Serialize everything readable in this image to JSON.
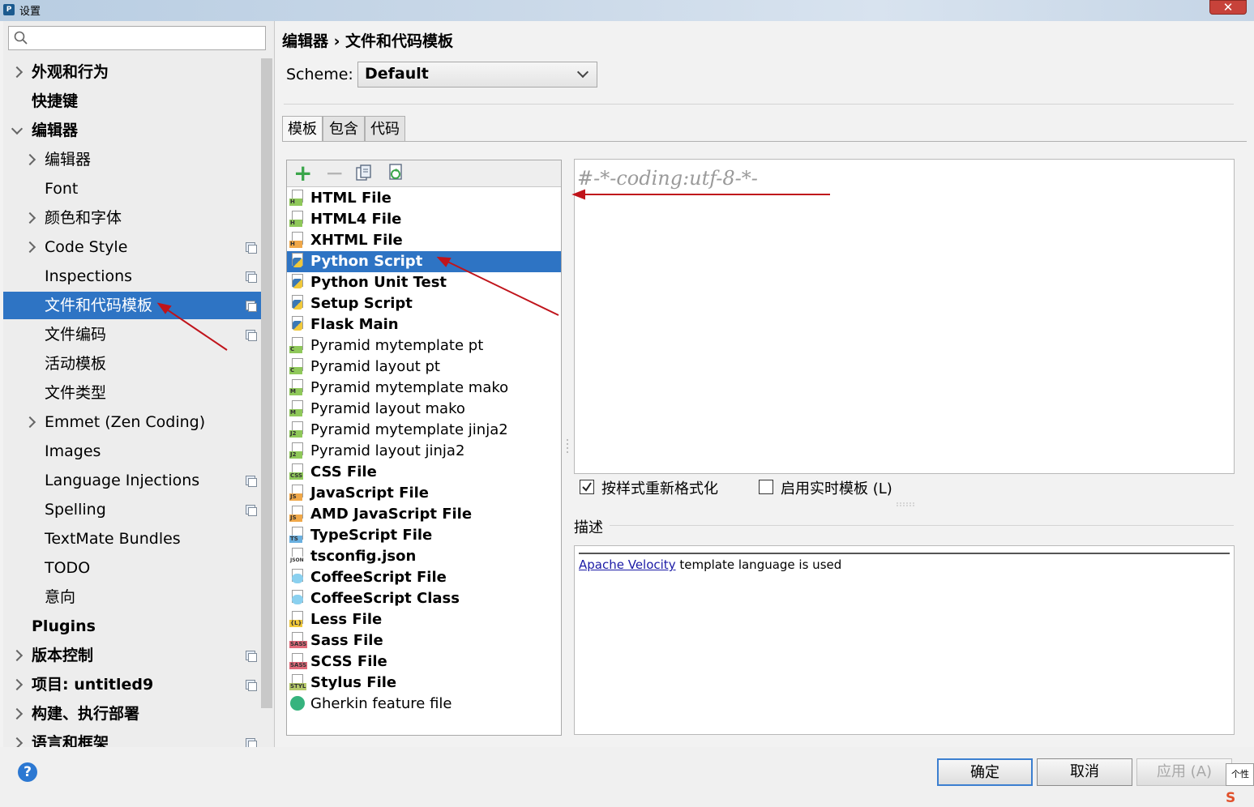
{
  "window": {
    "title": "设置",
    "close_label": "✕"
  },
  "sidebar": {
    "search_placeholder": "",
    "items": [
      {
        "label": "外观和行为",
        "arrow": "right",
        "bold": true,
        "copy": false
      },
      {
        "label": "快捷键",
        "arrow": "none",
        "bold": true,
        "copy": false
      },
      {
        "label": "编辑器",
        "arrow": "down",
        "bold": true,
        "copy": false
      },
      {
        "label": "编辑器",
        "arrow": "right",
        "bold": false,
        "copy": false
      },
      {
        "label": "Font",
        "arrow": "none",
        "bold": false,
        "copy": false
      },
      {
        "label": "颜色和字体",
        "arrow": "right",
        "bold": false,
        "copy": false
      },
      {
        "label": "Code Style",
        "arrow": "right",
        "bold": false,
        "copy": true
      },
      {
        "label": "Inspections",
        "arrow": "none",
        "bold": false,
        "copy": true
      },
      {
        "label": "文件和代码模板",
        "arrow": "none",
        "bold": false,
        "copy": true,
        "selected": true
      },
      {
        "label": "文件编码",
        "arrow": "none",
        "bold": false,
        "copy": true
      },
      {
        "label": "活动模板",
        "arrow": "none",
        "bold": false,
        "copy": false
      },
      {
        "label": "文件类型",
        "arrow": "none",
        "bold": false,
        "copy": false
      },
      {
        "label": "Emmet (Zen Coding)",
        "arrow": "right",
        "bold": false,
        "copy": false
      },
      {
        "label": "Images",
        "arrow": "none",
        "bold": false,
        "copy": false
      },
      {
        "label": "Language Injections",
        "arrow": "none",
        "bold": false,
        "copy": true
      },
      {
        "label": "Spelling",
        "arrow": "none",
        "bold": false,
        "copy": true
      },
      {
        "label": "TextMate Bundles",
        "arrow": "none",
        "bold": false,
        "copy": false
      },
      {
        "label": "TODO",
        "arrow": "none",
        "bold": false,
        "copy": false
      },
      {
        "label": "意向",
        "arrow": "none",
        "bold": false,
        "copy": false
      },
      {
        "label": "Plugins",
        "arrow": "none",
        "bold": true,
        "copy": false
      },
      {
        "label": "版本控制",
        "arrow": "right",
        "bold": true,
        "copy": true
      },
      {
        "label": "项目: untitled9",
        "arrow": "right",
        "bold": true,
        "copy": true
      },
      {
        "label": "构建、执行部署",
        "arrow": "right",
        "bold": true,
        "copy": false
      },
      {
        "label": "语言和框架",
        "arrow": "right",
        "bold": true,
        "copy": true
      }
    ]
  },
  "main": {
    "breadcrumb": "编辑器 › 文件和代码模板",
    "scheme_label": "Scheme:",
    "scheme_value": "Default",
    "tabs": [
      {
        "label": "模板"
      },
      {
        "label": "包含"
      },
      {
        "label": "代码"
      }
    ],
    "toolbar": {
      "add": "+",
      "remove": "−"
    },
    "templates": [
      {
        "label": "HTML File",
        "bold": true,
        "icon": "H",
        "color": "#8fc85a"
      },
      {
        "label": "HTML4 File",
        "bold": true,
        "icon": "H",
        "color": "#8fc85a"
      },
      {
        "label": "XHTML File",
        "bold": true,
        "icon": "H",
        "color": "#f0a849"
      },
      {
        "label": "Python Script",
        "bold": true,
        "icon": "py",
        "color": "#3a78b5",
        "selected": true
      },
      {
        "label": "Python Unit Test",
        "bold": true,
        "icon": "py",
        "color": "#3a78b5"
      },
      {
        "label": "Setup Script",
        "bold": true,
        "icon": "py",
        "color": "#3a78b5"
      },
      {
        "label": "Flask Main",
        "bold": true,
        "icon": "py",
        "color": "#3a78b5"
      },
      {
        "label": "Pyramid mytemplate pt",
        "bold": false,
        "icon": "C",
        "color": "#8fc85a"
      },
      {
        "label": "Pyramid layout pt",
        "bold": false,
        "icon": "C",
        "color": "#8fc85a"
      },
      {
        "label": "Pyramid mytemplate mako",
        "bold": false,
        "icon": "M",
        "color": "#8fc85a"
      },
      {
        "label": "Pyramid layout mako",
        "bold": false,
        "icon": "M",
        "color": "#8fc85a"
      },
      {
        "label": "Pyramid mytemplate jinja2",
        "bold": false,
        "icon": "J2",
        "color": "#8fc85a"
      },
      {
        "label": "Pyramid layout jinja2",
        "bold": false,
        "icon": "J2",
        "color": "#8fc85a"
      },
      {
        "label": "CSS File",
        "bold": true,
        "icon": "CSS",
        "color": "#8fc85a"
      },
      {
        "label": "JavaScript File",
        "bold": true,
        "icon": "JS",
        "color": "#f0a849"
      },
      {
        "label": "AMD JavaScript File",
        "bold": true,
        "icon": "JS",
        "color": "#f0a849"
      },
      {
        "label": "TypeScript File",
        "bold": true,
        "icon": "TS",
        "color": "#6ab0e0"
      },
      {
        "label": "tsconfig.json",
        "bold": true,
        "icon": "JSON",
        "color": "#ffffff"
      },
      {
        "label": "CoffeeScript File",
        "bold": true,
        "icon": "coffee",
        "color": "#8ad0ef"
      },
      {
        "label": "CoffeeScript Class",
        "bold": true,
        "icon": "coffee",
        "color": "#8ad0ef"
      },
      {
        "label": "Less File",
        "bold": true,
        "icon": "{L}",
        "color": "#f0c83a"
      },
      {
        "label": "Sass File",
        "bold": true,
        "icon": "SASS",
        "color": "#e06a7a"
      },
      {
        "label": "SCSS File",
        "bold": true,
        "icon": "SASS",
        "color": "#e06a7a"
      },
      {
        "label": "Stylus File",
        "bold": true,
        "icon": "STYL",
        "color": "#b5c96a"
      },
      {
        "label": "Gherkin feature file",
        "bold": false,
        "icon": "gherkin",
        "color": "#36b37e"
      }
    ],
    "editor_text": "#-*-coding:utf-8-*-",
    "reformat_label": "按样式重新格式化",
    "reformat_checked": true,
    "live_template_label": "启用实时模板 (L)",
    "live_template_checked": false,
    "description_label": "描述",
    "description_link": "Apache Velocity",
    "description_text": " template language is used"
  },
  "buttons": {
    "ok": "确定",
    "cancel": "取消",
    "apply": "应用 (A)",
    "help": "?"
  },
  "ime": {
    "tip": "个性",
    "logo": "S"
  },
  "colors": {
    "selection": "#2e74c4",
    "annotation_arrow": "#c0141b"
  }
}
